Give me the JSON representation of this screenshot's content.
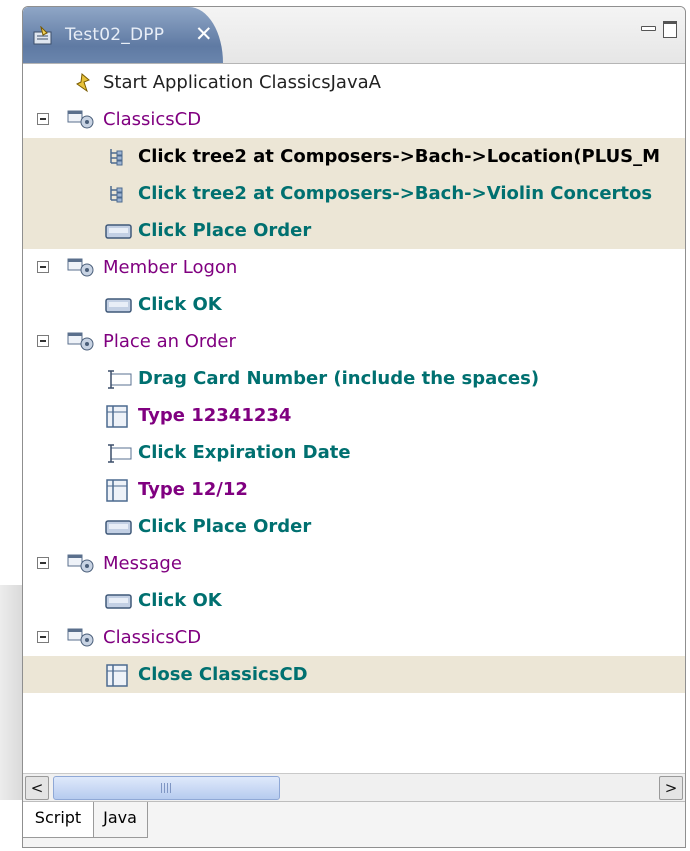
{
  "editor": {
    "tab_title": "Test02_DPP",
    "tab_close": "✕"
  },
  "tree": {
    "rows": [
      {
        "text": "Start  Application  ClassicsJavaA"
      },
      {
        "text": "ClassicsCD"
      },
      {
        "text": "Click  tree2  at  Composers->Bach->Location(PLUS_M"
      },
      {
        "text": "Click  tree2  at  Composers->Bach->Violin Concertos"
      },
      {
        "text": "Click  Place Order"
      },
      {
        "text": "Member Logon"
      },
      {
        "text": "Click  OK"
      },
      {
        "text": "Place an Order"
      },
      {
        "text": "Drag  Card Number (include the spaces)"
      },
      {
        "text": "Type  12341234"
      },
      {
        "text": "Click  Expiration Date"
      },
      {
        "text": "Type  12/12"
      },
      {
        "text": "Click  Place Order"
      },
      {
        "text": "Message"
      },
      {
        "text": "Click  OK"
      },
      {
        "text": "ClassicsCD"
      },
      {
        "text": "Close  ClassicsCD"
      }
    ]
  },
  "scrollbar": {
    "left_arrow": "<",
    "right_arrow": ">"
  },
  "bottom_tabs": {
    "script": "Script",
    "java": "Java"
  }
}
